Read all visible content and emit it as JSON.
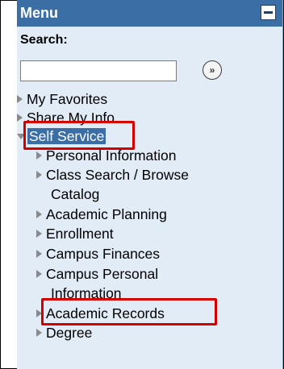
{
  "menu": {
    "title": "Menu",
    "search_label": "Search:",
    "search_value": "",
    "go_label": "»",
    "items": [
      {
        "label": "My Favorites"
      },
      {
        "label": "Share My Info"
      },
      {
        "label": "Self Service",
        "expanded": true
      },
      {
        "label": "Personal Information"
      },
      {
        "label": "Class Search / Browse",
        "label_line2": "Catalog"
      },
      {
        "label": "Academic Planning"
      },
      {
        "label": "Enrollment"
      },
      {
        "label": "Campus Finances"
      },
      {
        "label": "Campus Personal",
        "label_line2": "Information"
      },
      {
        "label": "Academic Records"
      },
      {
        "label": "Degree"
      }
    ]
  },
  "colors": {
    "header_bg": "#3a6ea5",
    "panel_bg": "#e2ecf7",
    "highlight": "#d40000"
  }
}
